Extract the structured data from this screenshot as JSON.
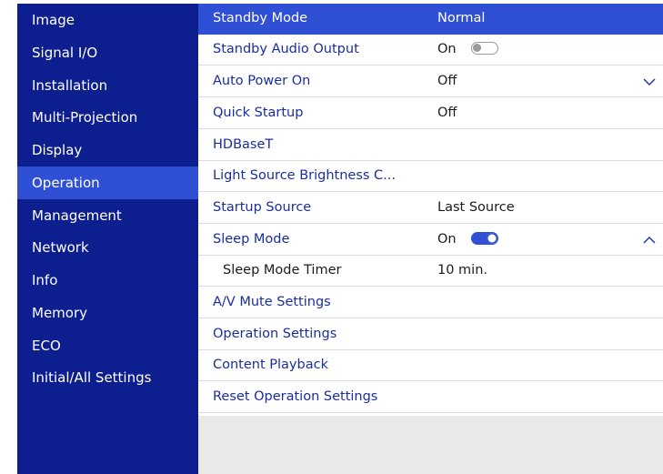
{
  "sidebar": {
    "items": [
      {
        "label": "Image"
      },
      {
        "label": "Signal I/O"
      },
      {
        "label": "Installation"
      },
      {
        "label": "Multi-Projection"
      },
      {
        "label": "Display"
      },
      {
        "label": "Operation",
        "active": true
      },
      {
        "label": "Management"
      },
      {
        "label": "Network"
      },
      {
        "label": "Info"
      },
      {
        "label": "Memory"
      },
      {
        "label": "ECO"
      },
      {
        "label": "Initial/All Settings"
      }
    ]
  },
  "settings": {
    "rows": [
      {
        "label": "Standby Mode",
        "value": "Normal",
        "selected": true
      },
      {
        "label": "Standby Audio Output",
        "value": "On",
        "toggle": "off"
      },
      {
        "label": "Auto Power On",
        "value": "Off",
        "chevron": "down"
      },
      {
        "label": "Quick Startup",
        "value": "Off"
      },
      {
        "label": "HDBaseT",
        "value": ""
      },
      {
        "label": "Light Source Brightness C...",
        "value": ""
      },
      {
        "label": "Startup Source",
        "value": "Last Source"
      },
      {
        "label": "Sleep Mode",
        "value": "On",
        "toggle": "on",
        "chevron": "up"
      },
      {
        "label": "Sleep Mode Timer",
        "value": "10 min.",
        "sub": true
      },
      {
        "label": "A/V Mute Settings",
        "value": ""
      },
      {
        "label": "Operation Settings",
        "value": ""
      },
      {
        "label": "Content Playback",
        "value": ""
      },
      {
        "label": "Reset Operation Settings",
        "value": ""
      }
    ]
  },
  "colors": {
    "sidebar_bg": "#0d1f8f",
    "highlight": "#2f4fd4",
    "label_text": "#1a2e9e"
  },
  "icons": {
    "toggle": "toggle-switch-icon",
    "expand": "chevron-down-icon",
    "collapse": "chevron-up-icon"
  }
}
